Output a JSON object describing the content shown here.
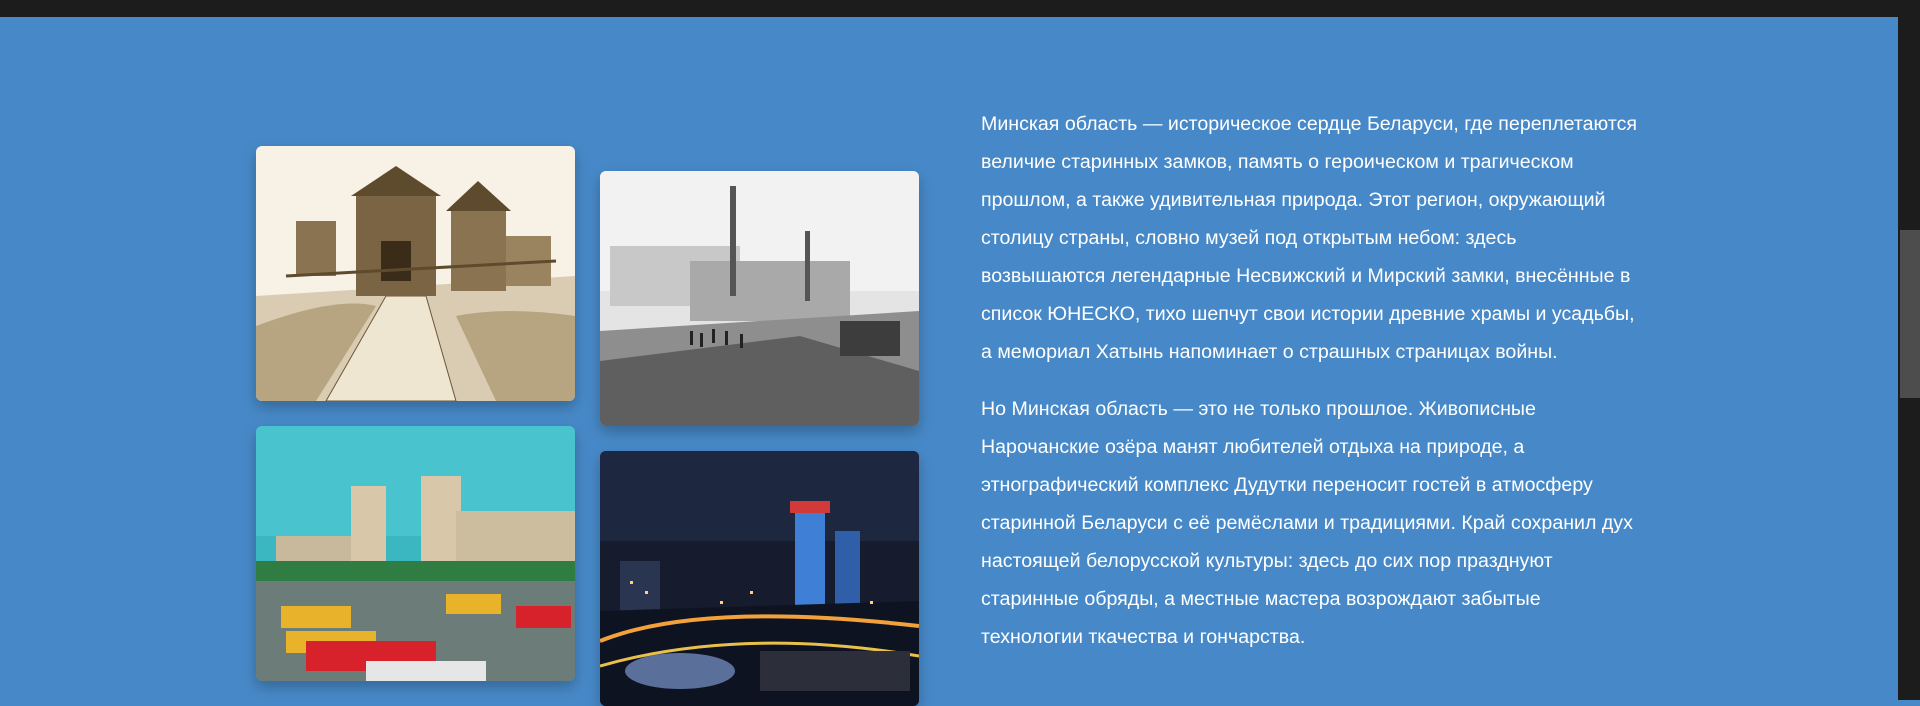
{
  "content": {
    "paragraphs": [
      "Минская область — историческое сердце Беларуси, где переплетаются величие старинных замков, память о героическом и трагическом прошлом, а также удивительная природа. Этот регион, окружающий столицу страны, словно музей под открытым небом: здесь возвышаются легендарные Несвижский и Мирский замки, внесённые в список ЮНЕСКО, тихо шепчут свои истории древние храмы и усадьбы, а мемориал Хатынь напоминает о страшных страницах войны.",
      "Но Минская область — это не только прошлое. Живописные Нарочанские озёра манят любителей отдыха на природе, а этнографический комплекс Дудутки переносит гостей в атмосферу старинной Беларуси с её ремёслами и традициями. Край сохранил дух настоящей белорусской культуры: здесь до сих пор празднуют старинные обряды, а местные мастера возрождают забытые технологии ткачества и гончарства."
    ]
  },
  "gallery": {
    "images": [
      {
        "subject": "wooden-fortress-sketch"
      },
      {
        "subject": "construction-site-bw"
      },
      {
        "subject": "railway-station-square-vintage"
      },
      {
        "subject": "city-at-night"
      }
    ]
  },
  "colors": {
    "section_background": "#4789c8",
    "top_bar": "#1c1c1c",
    "text": "#ffffff"
  }
}
